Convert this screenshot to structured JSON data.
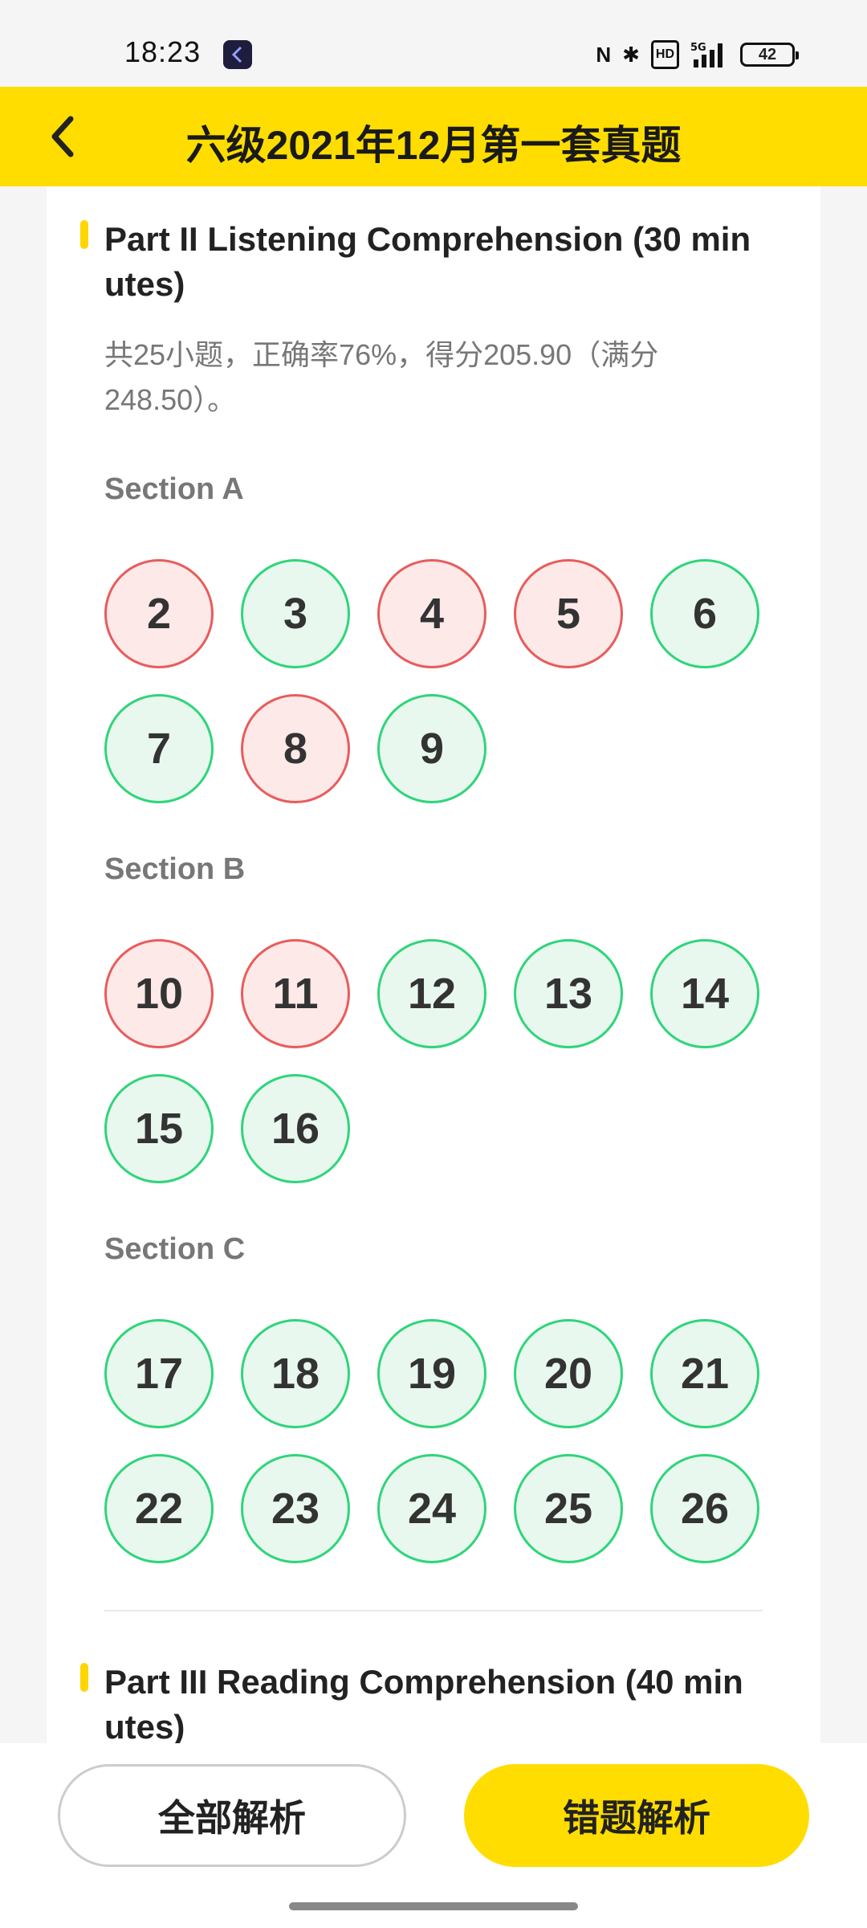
{
  "status_bar": {
    "time": "18:23",
    "icons": [
      "nfc-icon",
      "bluetooth-icon",
      "hd-icon",
      "signal-5g-icon",
      "battery-icon"
    ],
    "nfc": "N",
    "bluetooth": "✱",
    "hd": "HD",
    "network": "5G",
    "battery": "42"
  },
  "header": {
    "title": "六级2021年12月第一套真题",
    "background": "#ffdd00"
  },
  "parts": [
    {
      "title": "Part II Listening Comprehension (30 minutes)",
      "title_line1": "Part II Listening Comprehension (30 min",
      "title_line2": "utes)",
      "summary_line1": "共25小题，正确率76%，得分205.90（满分",
      "summary_line2": "248.50）。",
      "sections": [
        {
          "label": "Section A",
          "questions": [
            {
              "num": "2",
              "status": "wrong"
            },
            {
              "num": "3",
              "status": "correct"
            },
            {
              "num": "4",
              "status": "wrong"
            },
            {
              "num": "5",
              "status": "wrong"
            },
            {
              "num": "6",
              "status": "correct"
            },
            {
              "num": "7",
              "status": "correct"
            },
            {
              "num": "8",
              "status": "wrong"
            },
            {
              "num": "9",
              "status": "correct"
            }
          ]
        },
        {
          "label": "Section B",
          "questions": [
            {
              "num": "10",
              "status": "wrong"
            },
            {
              "num": "11",
              "status": "wrong"
            },
            {
              "num": "12",
              "status": "correct"
            },
            {
              "num": "13",
              "status": "correct"
            },
            {
              "num": "14",
              "status": "correct"
            },
            {
              "num": "15",
              "status": "correct"
            },
            {
              "num": "16",
              "status": "correct"
            }
          ]
        },
        {
          "label": "Section C",
          "questions": [
            {
              "num": "17",
              "status": "correct"
            },
            {
              "num": "18",
              "status": "correct"
            },
            {
              "num": "19",
              "status": "correct"
            },
            {
              "num": "20",
              "status": "correct"
            },
            {
              "num": "21",
              "status": "correct"
            },
            {
              "num": "22",
              "status": "correct"
            },
            {
              "num": "23",
              "status": "correct"
            },
            {
              "num": "24",
              "status": "correct"
            },
            {
              "num": "25",
              "status": "correct"
            },
            {
              "num": "26",
              "status": "correct"
            }
          ]
        }
      ]
    },
    {
      "title": "Part III Reading Comprehension (40 minutes)",
      "title_line1": "Part III Reading Comprehension (40 min",
      "title_line2": "utes)"
    }
  ],
  "colors": {
    "correct_border": "#2fd57a",
    "correct_fill": "#e8f8ee",
    "wrong_border": "#e85c5c",
    "wrong_fill": "#fde9e8",
    "accent": "#ffdd00"
  },
  "footer": {
    "all_analysis_label": "全部解析",
    "wrong_analysis_label": "错题解析"
  }
}
